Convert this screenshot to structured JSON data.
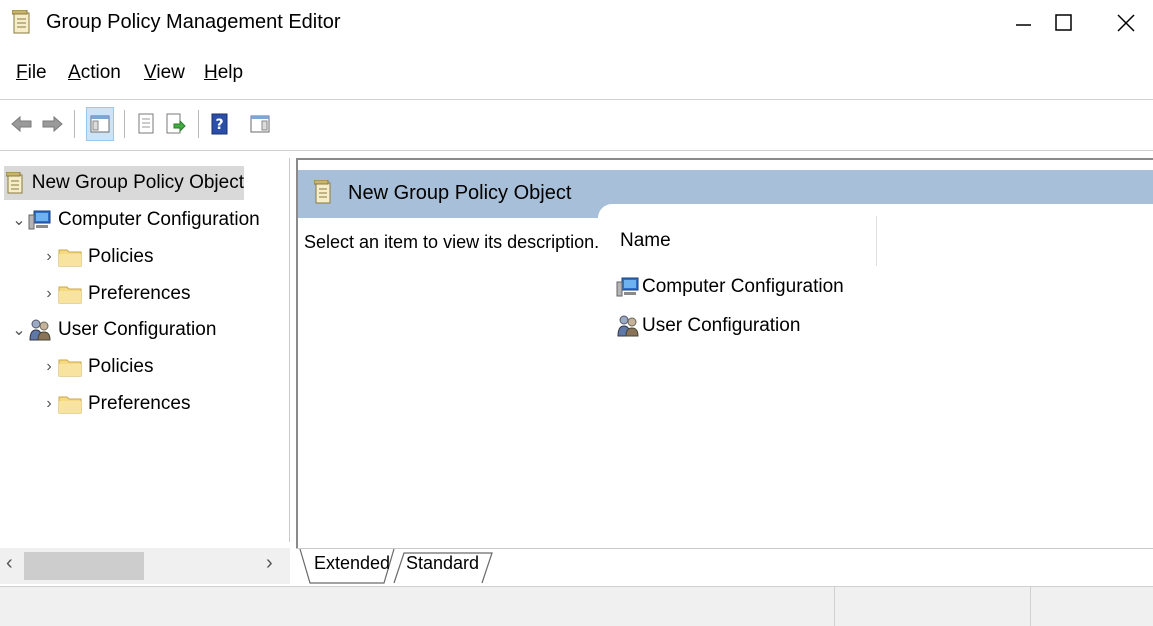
{
  "window": {
    "title": "Group Policy Management Editor",
    "controls": [
      "minimize",
      "maximize",
      "close"
    ]
  },
  "menu": {
    "items": [
      {
        "label": "File",
        "accel": "F"
      },
      {
        "label": "Action",
        "accel": "A"
      },
      {
        "label": "View",
        "accel": "V"
      },
      {
        "label": "Help",
        "accel": "H"
      }
    ]
  },
  "toolbar": {
    "buttons": [
      "back-icon",
      "forward-icon",
      "show-hide-tree-icon",
      "properties-icon",
      "export-list-icon",
      "help-icon",
      "show-hide-action-pane-icon"
    ]
  },
  "tree": {
    "root": "New Group Policy Object",
    "computer_config": "Computer Configuration",
    "computer_policies": "Policies",
    "computer_preferences": "Preferences",
    "user_config": "User Configuration",
    "user_policies": "Policies",
    "user_preferences": "Preferences"
  },
  "details": {
    "title": "New Group Policy Object",
    "description": "Select an item to view its description.",
    "column_name": "Name",
    "rows": [
      "Computer Configuration",
      "User Configuration"
    ]
  },
  "tabs": {
    "extended": "Extended",
    "standard": "Standard",
    "active": "Extended"
  },
  "colors": {
    "header_blue": "#a7bfd8",
    "selection_gray": "#d9d9d9",
    "folder_yellow": "#f5d983"
  }
}
